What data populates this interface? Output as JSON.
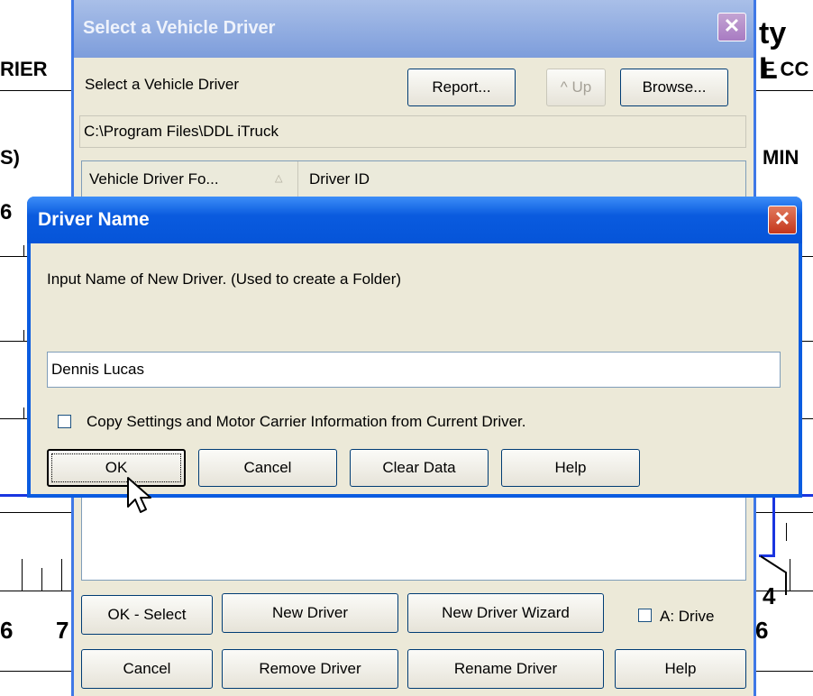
{
  "background": {
    "left_fragments": [
      "RIER",
      "S)",
      "6",
      "6",
      "7"
    ],
    "right_fragments": [
      "ty L",
      "F CC",
      "MIN",
      "4",
      "6"
    ]
  },
  "outer_dialog": {
    "title": "Select a Vehicle Driver",
    "prompt": "Select a Vehicle Driver",
    "buttons": {
      "report": "Report...",
      "up": "^ Up",
      "browse": "Browse..."
    },
    "path": "C:\\Program Files\\DDL iTruck",
    "columns": [
      "Vehicle Driver Fo...",
      "Driver ID"
    ],
    "sort_icon": "triangle-up-icon",
    "bottom_buttons": {
      "ok_select": "OK - Select",
      "new_driver": "New Driver",
      "new_driver_wizard": "New Driver Wizard",
      "a_drive": "A: Drive",
      "cancel": "Cancel",
      "remove_driver": "Remove Driver",
      "rename_driver": "Rename Driver",
      "help": "Help"
    }
  },
  "inner_dialog": {
    "title": "Driver Name",
    "message": "Input Name of New Driver. (Used to create a Folder)",
    "name_value": "Dennis Lucas",
    "copy_label": "Copy Settings and Motor Carrier Information from Current Driver.",
    "buttons": {
      "ok": "OK",
      "cancel": "Cancel",
      "clear_data": "Clear Data",
      "help": "Help"
    }
  },
  "colors": {
    "titlebar": "#0a5bdf",
    "close": "#d5492b",
    "face": "#ece9d8",
    "accent_line": "#1a35e0"
  }
}
